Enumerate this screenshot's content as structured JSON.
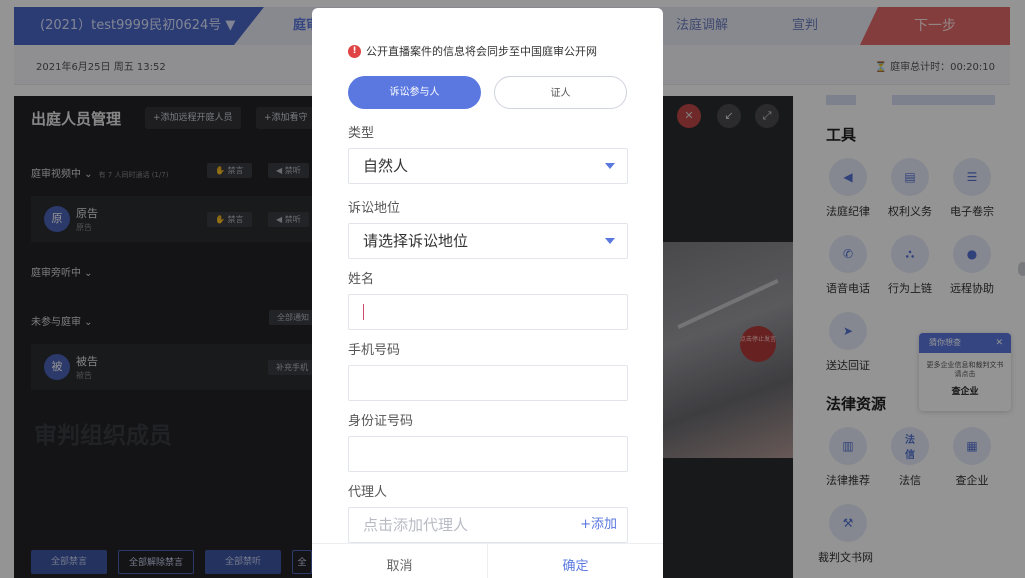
{
  "header": {
    "case_number": "(2021）test9999民初0624号 ▼",
    "steps": [
      "庭审准备",
      "法庭调解",
      "宣判"
    ],
    "next_step": "下一步",
    "datetime": "2021年6月25日  周五  13:52",
    "timer": "庭审总计时：00:20:10"
  },
  "left_panel": {
    "title": "出庭人员管理",
    "add_remote_btn": "+添加远程开庭人员",
    "add_viewer_btn": "+添加看守",
    "section_video": "庭审视频中 ⌄",
    "section_video_note": "有 7 人同时通话 (1/7)",
    "mute_btn": "禁言",
    "deafen_btn": "禁听",
    "plaintiff_avatar": "原",
    "plaintiff_name": "原告",
    "plaintiff_role": "原告",
    "section_audit": "庭审旁听中 ⌄",
    "section_absent": "未参与庭审 ⌄",
    "notify_all_btn": "全部通知",
    "defendant_avatar": "被",
    "defendant_name": "被告",
    "defendant_role": "被告",
    "supplement_phone_btn": "补充手机",
    "watermark": "审判组织成员",
    "bottom_buttons": [
      "全部禁言",
      "全部解除禁言",
      "全部禁听",
      "全"
    ]
  },
  "video": {
    "stop_speaking_btn": "点击停止发言"
  },
  "right_panel": {
    "tools_title": "工具",
    "tools": [
      {
        "label": "法庭纪律",
        "icon": "speaker-icon"
      },
      {
        "label": "权利义务",
        "icon": "document-icon"
      },
      {
        "label": "电子卷宗",
        "icon": "file-icon"
      },
      {
        "label": "语音电话",
        "icon": "phone-icon"
      },
      {
        "label": "行为上链",
        "icon": "network-icon"
      },
      {
        "label": "远程协助",
        "icon": "chat-icon"
      },
      {
        "label": "送达回证",
        "icon": "send-icon"
      }
    ],
    "legal_title": "法律资源",
    "legal": [
      {
        "label": "法律推荐",
        "icon": "book-icon"
      },
      {
        "label": "法信",
        "icon": "faxin-icon",
        "glyph": "法信"
      },
      {
        "label": "查企业",
        "icon": "building-icon"
      },
      {
        "label": "裁判文书网",
        "icon": "gavel-icon"
      }
    ],
    "tooltip": {
      "title": "猜你想查",
      "body": "更多企业信息和裁判文书请点击",
      "link": "查企业"
    }
  },
  "modal": {
    "notice": "公开直播案件的信息将会同步至中国庭审公开网",
    "tab_litigant": "诉讼参与人",
    "tab_witness": "证人",
    "type_label": "类型",
    "type_value": "自然人",
    "position_label": "诉讼地位",
    "position_placeholder": "请选择诉讼地位",
    "name_label": "姓名",
    "phone_label": "手机号码",
    "id_label": "身份证号码",
    "agent_label": "代理人",
    "agent_placeholder": "点击添加代理人",
    "agent_add": "+添加",
    "cancel": "取消",
    "confirm": "确定"
  }
}
